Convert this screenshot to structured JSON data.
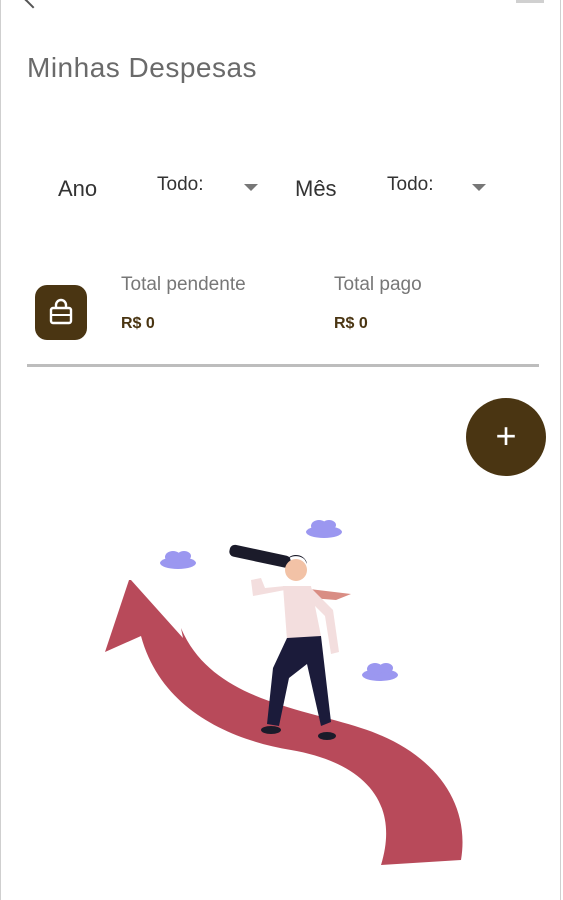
{
  "header": {
    "title": "Minhas Despesas"
  },
  "filters": {
    "year_label": "Ano",
    "year_value": "Todo:",
    "month_label": "Mês",
    "month_value": "Todo:"
  },
  "summary": {
    "pending_label": "Total pendente",
    "pending_value": "R$ 0",
    "paid_label": "Total pago",
    "paid_value": "R$ 0"
  },
  "actions": {
    "add_label": "+"
  },
  "colors": {
    "accent": "#4a3512",
    "arrow": "#b84a5a",
    "cloud": "#9b97f0"
  },
  "icons": [
    "back-icon",
    "menu-icon",
    "shopping-bag-icon",
    "plus-icon"
  ]
}
